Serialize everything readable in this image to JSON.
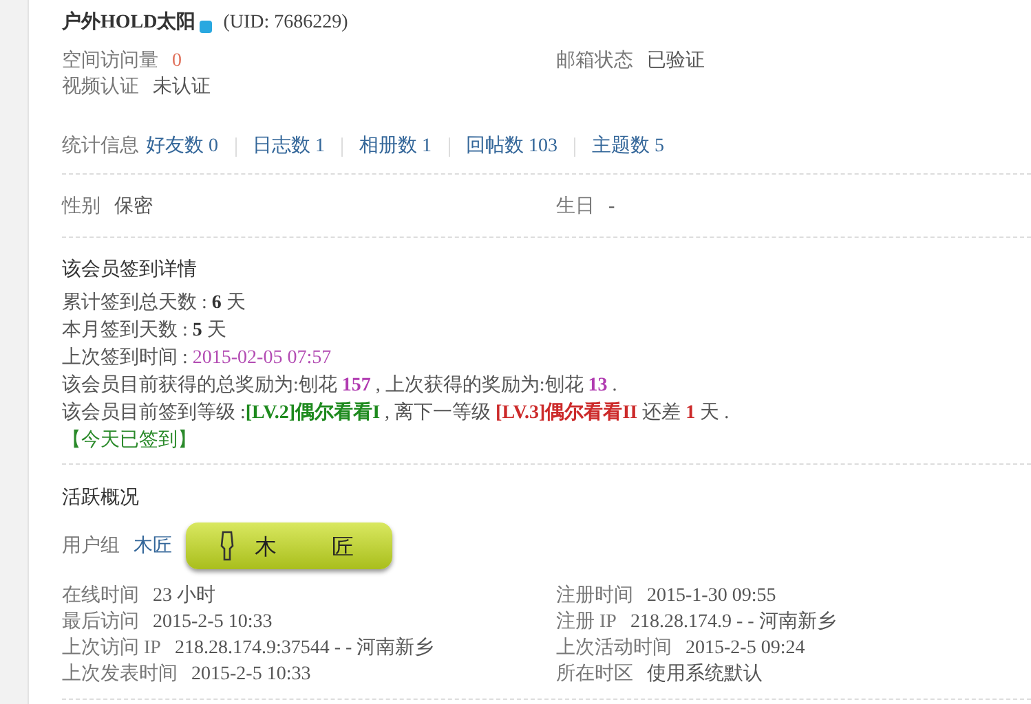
{
  "profile": {
    "name": "户外HOLD太阳",
    "online": true,
    "uid": "(UID: 7686229)"
  },
  "info": {
    "left": [
      {
        "label": "空间访问量",
        "value": "0",
        "kind": "count"
      },
      {
        "label": "视频认证",
        "value": "未认证",
        "kind": "plain"
      }
    ],
    "right": [
      {
        "label": "邮箱状态",
        "value": "已验证",
        "kind": "plain"
      }
    ]
  },
  "stats": {
    "label": "统计信息",
    "items": [
      "好友数 0",
      "日志数 1",
      "相册数 1",
      "回帖数 103",
      "主题数 5"
    ]
  },
  "personal": [
    {
      "label": "性别",
      "value": "保密"
    },
    {
      "label": "生日",
      "value": "-"
    }
  ],
  "signin": {
    "title": "该会员签到详情",
    "lines": [
      [
        {
          "text": "累计签到总天数 : ",
          "kind": "plain"
        },
        {
          "text": "6",
          "kind": "bold"
        },
        {
          "text": " 天",
          "kind": "plain"
        }
      ],
      [
        {
          "text": "本月签到天数 : ",
          "kind": "plain"
        },
        {
          "text": "5",
          "kind": "bold"
        },
        {
          "text": " 天",
          "kind": "plain"
        }
      ],
      [
        {
          "text": "上次签到时间 : ",
          "kind": "plain"
        },
        {
          "text": "2015-02-05 07:57",
          "kind": "date"
        }
      ],
      [
        {
          "text": "该会员目前获得的总奖励为:刨花 ",
          "kind": "plain"
        },
        {
          "text": "157",
          "kind": "reward"
        },
        {
          "text": " , 上次获得的奖励为:刨花 ",
          "kind": "plain"
        },
        {
          "text": "13",
          "kind": "reward"
        },
        {
          "text": " .",
          "kind": "plain"
        }
      ],
      [
        {
          "text": "该会员目前签到等级 :",
          "kind": "plain"
        },
        {
          "text": "[LV.2]偶尔看看I",
          "kind": "level_current"
        },
        {
          "text": " , 离下一等级 ",
          "kind": "plain"
        },
        {
          "text": "[LV.3]偶尔看看II",
          "kind": "level_next"
        },
        {
          "text": " 还差 ",
          "kind": "plain"
        },
        {
          "text": "1",
          "kind": "level_next"
        },
        {
          "text": " 天 .",
          "kind": "plain"
        }
      ]
    ],
    "status": "【今天已签到】"
  },
  "activity": {
    "title": "活跃概况",
    "group_label": "用户组",
    "group": "木匠",
    "badge": "木　匠",
    "left": [
      {
        "label": "在线时间",
        "value": "23 小时"
      },
      {
        "label": "最后访问",
        "value": "2015-2-5 10:33"
      },
      {
        "label": "上次访问 IP",
        "value": "218.28.174.9:37544 - - 河南新乡"
      },
      {
        "label": "上次发表时间",
        "value": "2015-2-5 10:33"
      }
    ],
    "right": [
      {
        "label": "注册时间",
        "value": "2015-1-30 09:55"
      },
      {
        "label": "注册 IP",
        "value": "218.28.174.9 - - 河南新乡"
      },
      {
        "label": "上次活动时间",
        "value": "2015-2-5 09:24"
      },
      {
        "label": "所在时区",
        "value": "使用系统默认"
      }
    ]
  }
}
